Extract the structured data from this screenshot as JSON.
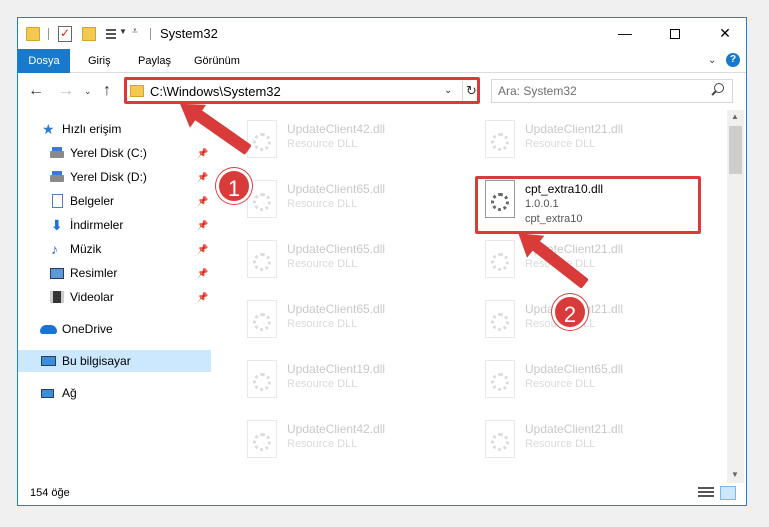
{
  "window": {
    "title": "System32",
    "controls": {
      "minimize": "—",
      "maximize": "",
      "close": "✕"
    }
  },
  "ribbon": {
    "tabs": [
      "Dosya",
      "Giriş",
      "Paylaş",
      "Görünüm"
    ]
  },
  "nav": {
    "address": "C:\\Windows\\System32",
    "search_placeholder": "Ara: System32"
  },
  "sidebar": {
    "items": [
      {
        "label": "Hızlı erişim",
        "icon": "star-icon"
      },
      {
        "label": "Yerel Disk (C:)",
        "icon": "drive-icon",
        "pinned": true
      },
      {
        "label": "Yerel Disk (D:)",
        "icon": "drive-icon",
        "pinned": true
      },
      {
        "label": "Belgeler",
        "icon": "documents-icon",
        "pinned": true
      },
      {
        "label": "İndirmeler",
        "icon": "downloads-icon",
        "pinned": true
      },
      {
        "label": "Müzik",
        "icon": "music-icon",
        "pinned": true
      },
      {
        "label": "Resimler",
        "icon": "pictures-icon",
        "pinned": true
      },
      {
        "label": "Videolar",
        "icon": "videos-icon",
        "pinned": true
      },
      {
        "label": "OneDrive",
        "icon": "cloud-icon"
      },
      {
        "label": "Bu bilgisayar",
        "icon": "computer-icon",
        "selected": true
      },
      {
        "label": "Ağ",
        "icon": "network-icon"
      }
    ]
  },
  "files": [
    {
      "name": "UpdateClient42.dll",
      "desc": "Resource DLL"
    },
    {
      "name": "UpdateClient21.dll",
      "desc": "Resource DLL"
    },
    {
      "name": "UpdateClient65.dll",
      "desc": "Resource DLL"
    },
    {
      "name": "cpt_extra10.dll",
      "desc": "1.0.0.1",
      "line3": "cpt_extra10",
      "highlighted": true
    },
    {
      "name": "UpdateClient65.dll",
      "desc": "Resource DLL"
    },
    {
      "name": "UpdateClient21.dll",
      "desc": "Resource DLL"
    },
    {
      "name": "UpdateClient65.dll",
      "desc": "Resource DLL"
    },
    {
      "name": "UpdateClient21.dll",
      "desc": "Resource DLL"
    },
    {
      "name": "UpdateClient19.dll",
      "desc": "Resource DLL"
    },
    {
      "name": "UpdateClient65.dll",
      "desc": "Resource DLL"
    },
    {
      "name": "UpdateClient42.dll",
      "desc": "Resource DLL"
    },
    {
      "name": "UpdateClient21.dll",
      "desc": "Resource DLL"
    }
  ],
  "status": {
    "count": "154 öğe"
  },
  "annotations": {
    "step1": "1",
    "step2": "2",
    "color": "#d93b3b"
  }
}
